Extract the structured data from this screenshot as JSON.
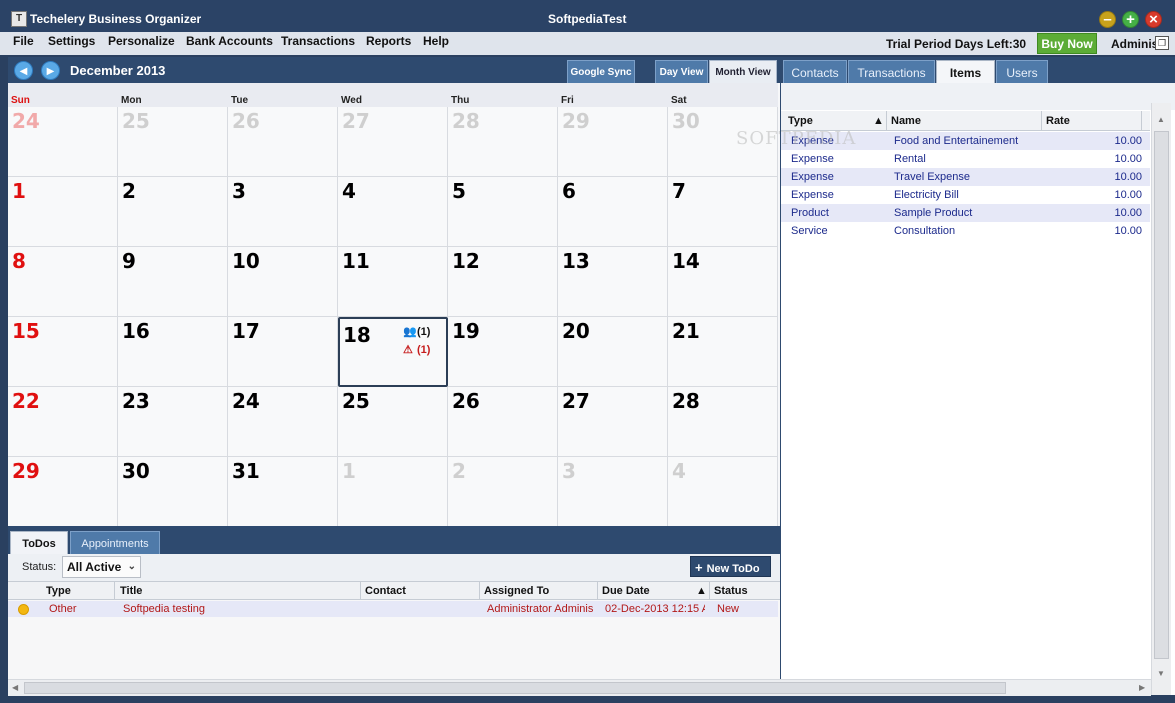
{
  "window": {
    "app_title": "Techelery Business Organizer",
    "doc_title": "SoftpediaTest",
    "minimize_glyph": "–",
    "maximize_glyph": "+",
    "close_glyph": "×"
  },
  "menu": {
    "items": [
      "File",
      "Settings",
      "Personalize",
      "Bank Accounts",
      "Transactions",
      "Reports",
      "Help"
    ],
    "trial_text": "Trial Period Days Left:30",
    "buy_now": "Buy Now",
    "user": "Administrator"
  },
  "calendar": {
    "month_title": "December 2013",
    "google_sync": "Google Sync",
    "day_view": "Day View",
    "month_view": "Month View",
    "days_of_week": [
      "Sun",
      "Mon",
      "Tue",
      "Wed",
      "Thu",
      "Fri",
      "Sat"
    ],
    "weeks": [
      [
        "24",
        "25",
        "26",
        "27",
        "28",
        "29",
        "30"
      ],
      [
        "1",
        "2",
        "3",
        "4",
        "5",
        "6",
        "7"
      ],
      [
        "8",
        "9",
        "10",
        "11",
        "12",
        "13",
        "14"
      ],
      [
        "15",
        "16",
        "17",
        "18",
        "19",
        "20",
        "21"
      ],
      [
        "22",
        "23",
        "24",
        "25",
        "26",
        "27",
        "28"
      ],
      [
        "29",
        "30",
        "31",
        "1",
        "2",
        "3",
        "4"
      ]
    ],
    "today_events": {
      "meetings": "(1)",
      "alerts": "(1)"
    }
  },
  "right_panel": {
    "tabs": [
      "Contacts",
      "Transactions",
      "Items",
      "Users"
    ],
    "active_tab": "Items",
    "columns": [
      "Type",
      "Name",
      "Rate"
    ],
    "rows": [
      {
        "type": "Expense",
        "name": "Food and Entertainement",
        "rate": "10.00"
      },
      {
        "type": "Expense",
        "name": "Rental",
        "rate": "10.00"
      },
      {
        "type": "Expense",
        "name": "Travel Expense",
        "rate": "10.00"
      },
      {
        "type": "Expense",
        "name": "Electricity Bill",
        "rate": "10.00"
      },
      {
        "type": "Product",
        "name": "Sample Product",
        "rate": "10.00"
      },
      {
        "type": "Service",
        "name": "Consultation",
        "rate": "10.00"
      }
    ]
  },
  "bottom_panel": {
    "tabs": [
      "ToDos",
      "Appointments"
    ],
    "status_label": "Status:",
    "status_value": "All Active",
    "new_todo": "New ToDo",
    "columns": [
      "Type",
      "Title",
      "Contact",
      "Assigned To",
      "Due Date",
      "Status"
    ],
    "rows": [
      {
        "type": "Other",
        "title": "Softpedia testing",
        "contact": "",
        "assigned_to": "Administrator Adminis",
        "due_date": "02-Dec-2013 12:15 A",
        "status": "New"
      }
    ]
  },
  "watermark": "SOFTPEDIA",
  "colors": {
    "titlebar": "#2b4366",
    "accent": "#2e4a6f",
    "buy_now": "#5cac36",
    "sunday": "#e01010"
  }
}
